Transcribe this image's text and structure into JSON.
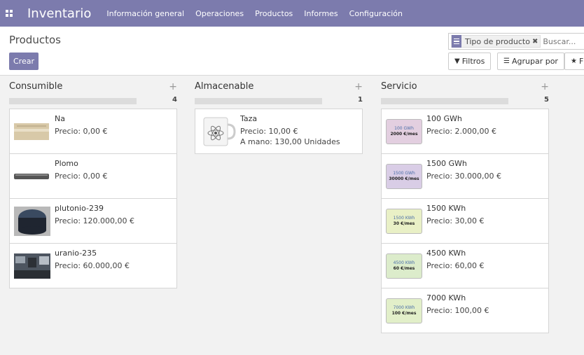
{
  "navbar": {
    "brand": "Inventario",
    "menu": [
      "Información general",
      "Operaciones",
      "Productos",
      "Informes",
      "Configuración"
    ]
  },
  "control": {
    "breadcrumb": "Productos",
    "create_label": "Crear",
    "search": {
      "facet_label": "Tipo de producto",
      "placeholder": "Buscar..."
    },
    "filters_label": "Filtros",
    "group_label": "Agrupar por",
    "favorites_label": "F"
  },
  "columns": [
    {
      "title": "Consumible",
      "count": "4",
      "cards": [
        {
          "name": "Na",
          "price": "Precio: 0,00 €",
          "image": "sodium-bar-image"
        },
        {
          "name": "Plomo",
          "price": "Precio: 0,00 €",
          "image": "lead-bar-image"
        },
        {
          "name": "plutonio-239",
          "price": "Precio: 120.000,00 €",
          "image": "plutonium-disc-image"
        },
        {
          "name": "uranio-235",
          "price": "Precio: 60.000,00 €",
          "image": "uranium-lab-image"
        }
      ]
    },
    {
      "title": "Almacenable",
      "count": "1",
      "cards": [
        {
          "name": "Taza",
          "price": "Precio: 10,00 €",
          "stock": "A mano: 130,00 Unidades",
          "image": "mug-image"
        }
      ]
    },
    {
      "title": "Servicio",
      "count": "5",
      "cards": [
        {
          "name": "100 GWh",
          "price": "Precio: 2.000,00 €",
          "image": "voucher-image",
          "voucher_top": "100 GWh",
          "voucher_bottom": "2000 €/mes",
          "color": "#e3cfe0"
        },
        {
          "name": "1500 GWh",
          "price": "Precio: 30.000,00 €",
          "image": "voucher-image",
          "voucher_top": "1500 GWh",
          "voucher_bottom": "30000 €/mes",
          "color": "#d9cde6"
        },
        {
          "name": "1500 KWh",
          "price": "Precio: 30,00 €",
          "image": "voucher-image",
          "voucher_top": "1500 KWh",
          "voucher_bottom": "30 €/mes",
          "color": "#e9f0c6"
        },
        {
          "name": "4500 KWh",
          "price": "Precio: 60,00 €",
          "image": "voucher-image",
          "voucher_top": "4500 KWh",
          "voucher_bottom": "60 €/mes",
          "color": "#dceccb"
        },
        {
          "name": "7000 KWh",
          "price": "Precio: 100,00 €",
          "image": "voucher-image",
          "voucher_top": "7000 KWh",
          "voucher_bottom": "100 €/mes",
          "color": "#e2efc9"
        }
      ]
    }
  ],
  "colors": {
    "brand": "#7c7bad",
    "background": "#f2f2f2"
  }
}
